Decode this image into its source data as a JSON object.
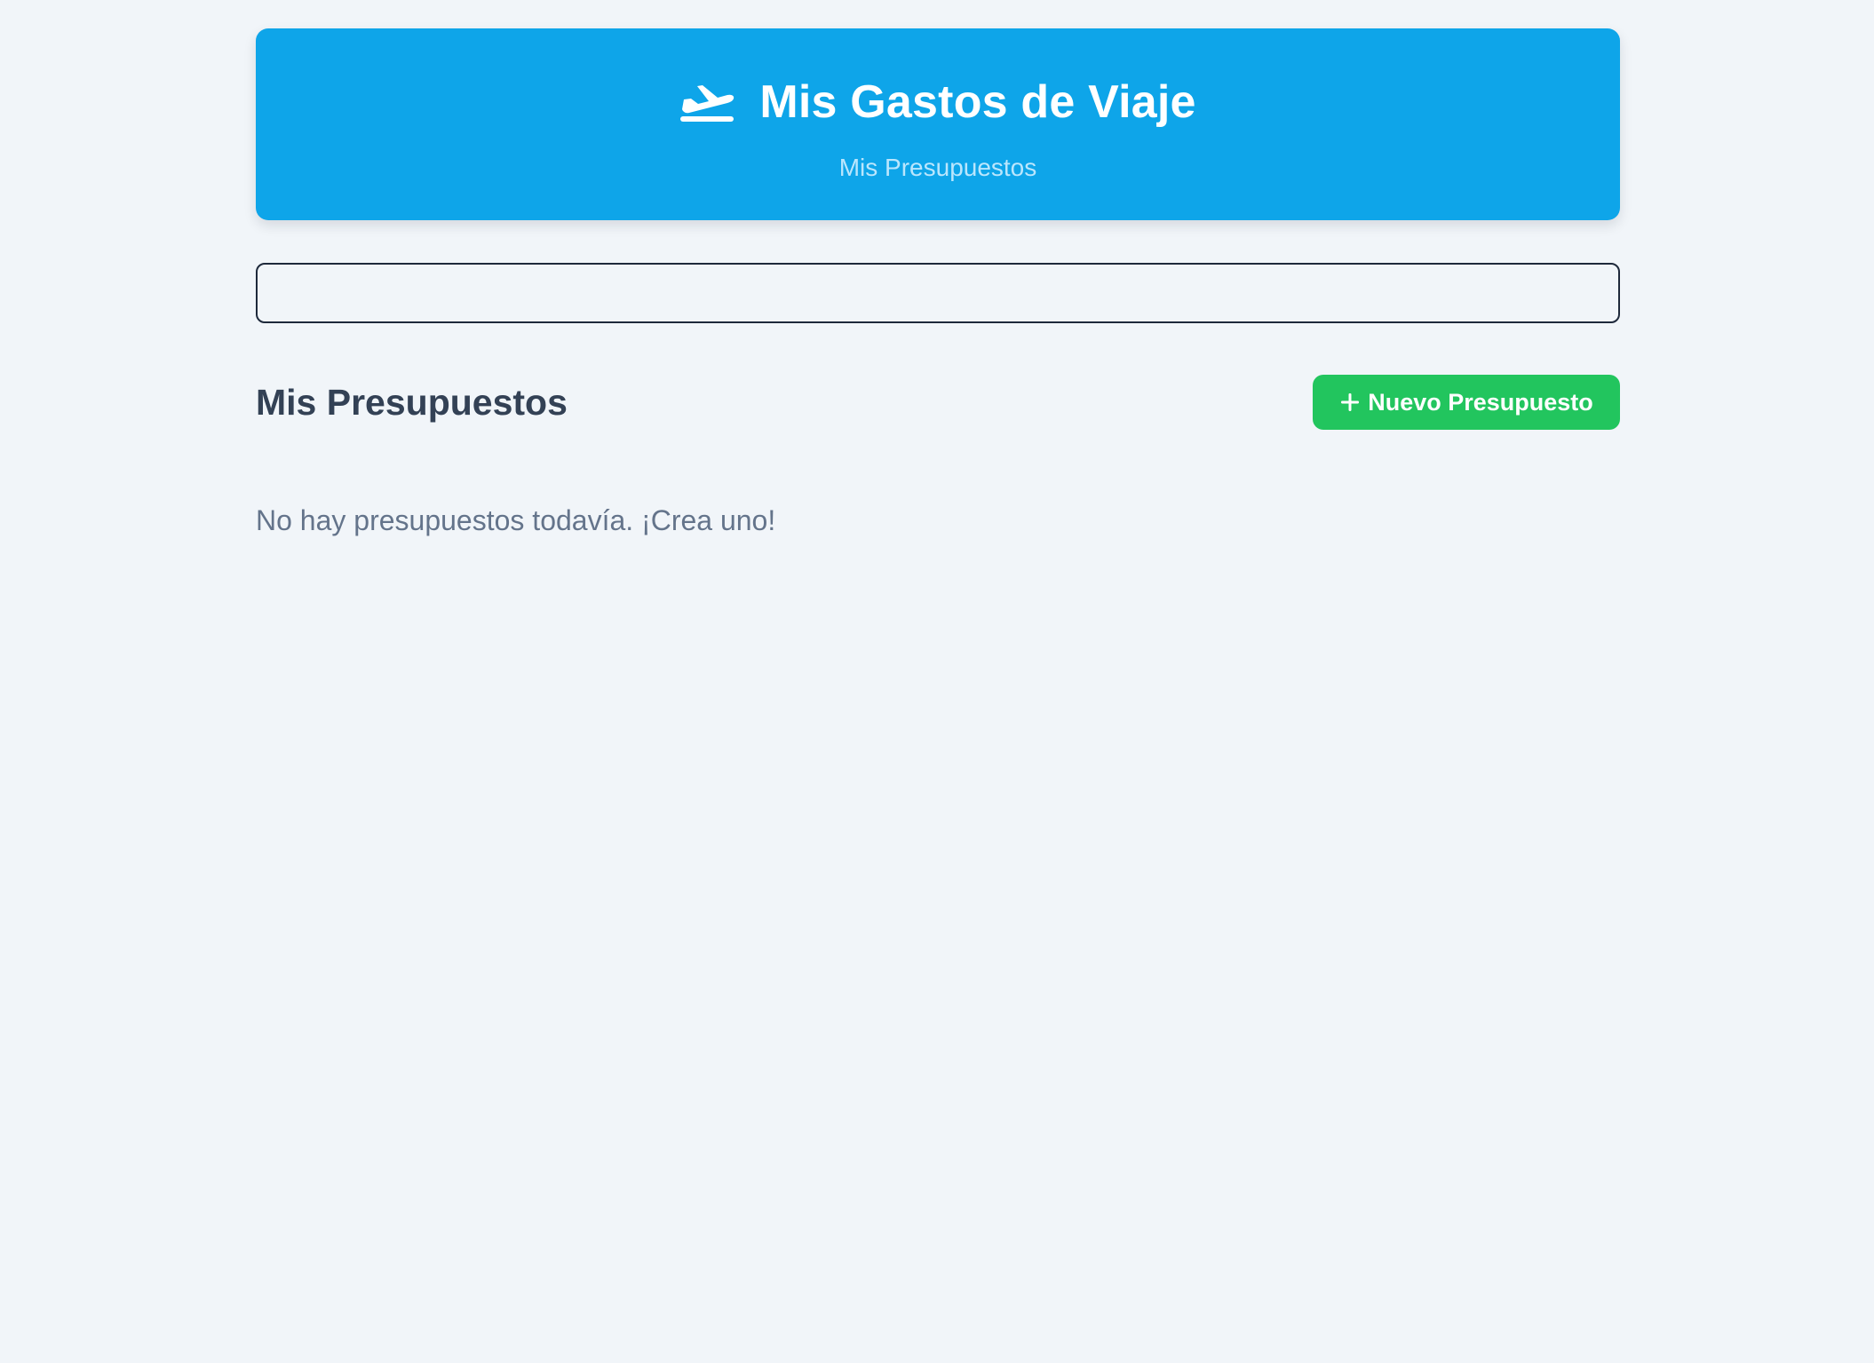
{
  "header": {
    "icon": "airplane-departure-icon",
    "title": "Mis Gastos de Viaje",
    "subtitle": "Mis Presupuestos",
    "background_color": "#0ea5e9"
  },
  "budget_picker": {
    "value": ""
  },
  "budgets_section": {
    "title": "Mis Presupuestos",
    "new_button": {
      "icon": "plus-icon",
      "label": "Nuevo Presupuesto",
      "color": "#22c55e"
    },
    "empty_message": "No hay presupuestos todavía. ¡Crea uno!"
  }
}
